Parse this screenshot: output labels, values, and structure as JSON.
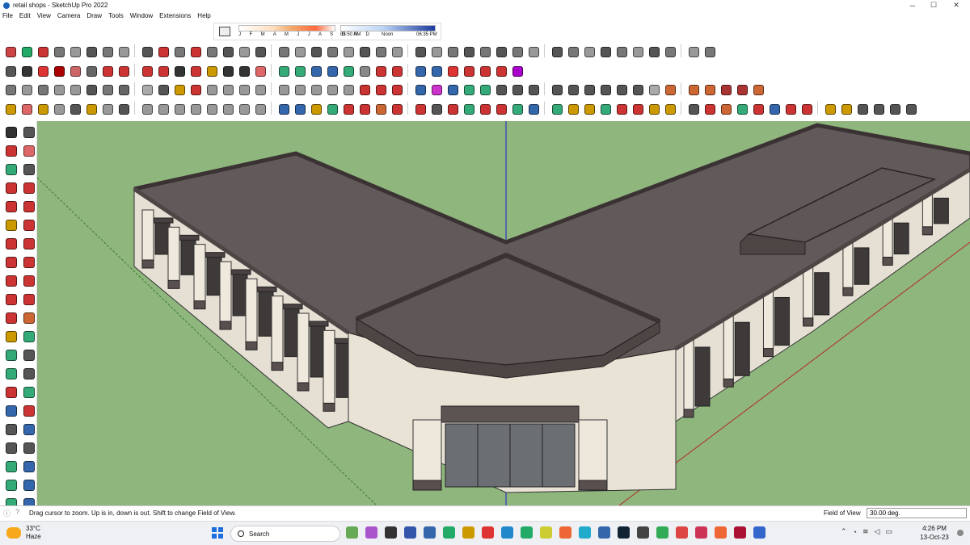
{
  "window": {
    "title": "retail shops - SketchUp Pro 2022",
    "minimize": "─",
    "maximize": "☐",
    "close": "✕"
  },
  "menu": [
    "File",
    "Edit",
    "View",
    "Camera",
    "Draw",
    "Tools",
    "Window",
    "Extensions",
    "Help"
  ],
  "shadow_settings": {
    "months": "J F M A M J J A S O N D",
    "time_start": "05:50 AM",
    "time_noon": "Noon",
    "time_end": "06:35 PM"
  },
  "toolbars": {
    "row1": [
      "#c44",
      "#2a6",
      "#c33",
      "#777",
      "#999",
      "#555",
      "#777",
      "#999",
      "#555",
      "#c33",
      "#777",
      "#c33",
      "#777",
      "#555",
      "#999",
      "#555",
      "#777",
      "#999",
      "#555",
      "#777",
      "#999",
      "#555",
      "#777",
      "#999",
      "#555",
      "#999",
      "#777",
      "#555",
      "#777",
      "#555",
      "#777",
      "#999",
      "#555",
      "#777",
      "#999",
      "#555",
      "#777",
      "#999",
      "#555",
      "#777",
      "#999",
      "#777"
    ],
    "row2": [
      "#555",
      "#333",
      "#d33",
      "#a00",
      "#c66",
      "#666",
      "#c33",
      "#c33",
      "#c33",
      "#c33",
      "#333",
      "#c33",
      "#c90",
      "#333",
      "#333",
      "#d66",
      "#3a7",
      "#3a7",
      "#36a",
      "#36a",
      "#3a7",
      "#888",
      "#c33",
      "#c33",
      "#36a",
      "#36a",
      "#d33",
      "#c33",
      "#c33",
      "#c33",
      "#a0c"
    ],
    "row3": [
      "#777",
      "#999",
      "#777",
      "#999",
      "#999",
      "#555",
      "#777",
      "#666",
      "#aaa",
      "#555",
      "#c90",
      "#c33",
      "#999",
      "#999",
      "#999",
      "#999",
      "#999",
      "#999",
      "#999",
      "#999",
      "#999",
      "#c33",
      "#c33",
      "#c33",
      "#36a",
      "#c3c",
      "#36a",
      "#3a7",
      "#3a7",
      "#555",
      "#555",
      "#555",
      "#555",
      "#555",
      "#555",
      "#555",
      "#555",
      "#555",
      "#aaa",
      "#c63",
      "#c63",
      "#c63",
      "#a33",
      "#a33",
      "#c63"
    ],
    "row4": [
      "#c90",
      "#d66",
      "#c90",
      "#999",
      "#555",
      "#c90",
      "#999",
      "#555",
      "#999",
      "#999",
      "#999",
      "#999",
      "#999",
      "#999",
      "#999",
      "#999",
      "#36a",
      "#36a",
      "#c90",
      "#3a7",
      "#c33",
      "#c33",
      "#c63",
      "#c33",
      "#c33",
      "#555",
      "#c33",
      "#3a7",
      "#c33",
      "#c33",
      "#3a7",
      "#36a",
      "#3a7",
      "#c90",
      "#c90",
      "#3a7",
      "#c33",
      "#c33",
      "#c90",
      "#c90",
      "#555",
      "#c33",
      "#c63",
      "#3a7",
      "#c33",
      "#36a",
      "#c33",
      "#c33",
      "#c90",
      "#c90",
      "#555",
      "#555",
      "#555",
      "#555"
    ]
  },
  "left_tools": [
    "#333",
    "#555",
    "#c33",
    "#d66",
    "#3a7",
    "#555",
    "#c33",
    "#c33",
    "#c33",
    "#c33",
    "#c90",
    "#c33",
    "#c33",
    "#c33",
    "#c33",
    "#c33",
    "#c33",
    "#c33",
    "#c33",
    "#c33",
    "#c33",
    "#c63",
    "#c90",
    "#3a7",
    "#3a7",
    "#555",
    "#3a7",
    "#555",
    "#c33",
    "#3a7",
    "#36a",
    "#c33",
    "#555",
    "#36a",
    "#555",
    "#555",
    "#3a7",
    "#36a",
    "#3a7",
    "#36a",
    "#3a7",
    "#36a"
  ],
  "statusbar": {
    "message": "Drag cursor to zoom.  Up is in, down is out. Shift to change Field of View.",
    "fov_label": "Field of View",
    "fov_value": "30.00 deg."
  },
  "taskbar": {
    "temperature": "33°C",
    "weather": "Haze",
    "search_label": "Search",
    "apps": [
      "#6a5",
      "#a5c",
      "#333",
      "#35a",
      "#36a",
      "#2a6",
      "#c90",
      "#d33",
      "#28c",
      "#2a6",
      "#cc3",
      "#e63",
      "#2ac",
      "#36a",
      "#123",
      "#444",
      "#3a5",
      "#d44",
      "#c35",
      "#e63",
      "#a13",
      "#36c"
    ],
    "time": "4:26 PM",
    "date": "13-Oct-23"
  },
  "colors": {
    "ground": "#8fb67d",
    "roof": "#625a5a",
    "parapet": "#4e4545",
    "wall": "#e6e0d4",
    "axis_blue": "#1b1bd0",
    "axis_green": "#3b7e32",
    "axis_red": "#b32a2a"
  }
}
